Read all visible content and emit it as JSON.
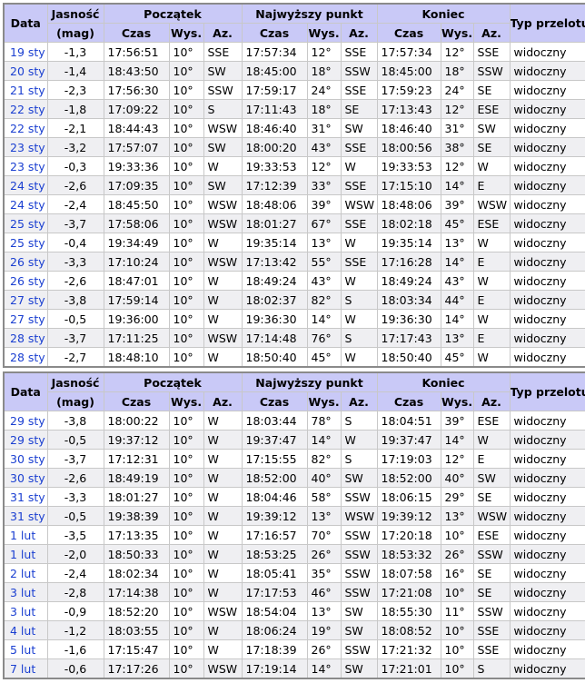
{
  "headers": {
    "date": "Data",
    "mag_top": "Jasność",
    "mag_bottom": "(mag)",
    "start": "Początek",
    "peak": "Najwyższy punkt",
    "end": "Koniec",
    "type": "Typ przelotu",
    "time": "Czas",
    "alt": "Wys.",
    "az": "Az."
  },
  "tables": [
    {
      "rows": [
        [
          "19 sty",
          "-1,3",
          "17:56:51",
          "10°",
          "SSE",
          "17:57:34",
          "12°",
          "SSE",
          "17:57:34",
          "12°",
          "SSE",
          "widoczny"
        ],
        [
          "20 sty",
          "-1,4",
          "18:43:50",
          "10°",
          "SW",
          "18:45:00",
          "18°",
          "SSW",
          "18:45:00",
          "18°",
          "SSW",
          "widoczny"
        ],
        [
          "21 sty",
          "-2,3",
          "17:56:30",
          "10°",
          "SSW",
          "17:59:17",
          "24°",
          "SSE",
          "17:59:23",
          "24°",
          "SE",
          "widoczny"
        ],
        [
          "22 sty",
          "-1,8",
          "17:09:22",
          "10°",
          "S",
          "17:11:43",
          "18°",
          "SE",
          "17:13:43",
          "12°",
          "ESE",
          "widoczny"
        ],
        [
          "22 sty",
          "-2,1",
          "18:44:43",
          "10°",
          "WSW",
          "18:46:40",
          "31°",
          "SW",
          "18:46:40",
          "31°",
          "SW",
          "widoczny"
        ],
        [
          "23 sty",
          "-3,2",
          "17:57:07",
          "10°",
          "SW",
          "18:00:20",
          "43°",
          "SSE",
          "18:00:56",
          "38°",
          "SE",
          "widoczny"
        ],
        [
          "23 sty",
          "-0,3",
          "19:33:36",
          "10°",
          "W",
          "19:33:53",
          "12°",
          "W",
          "19:33:53",
          "12°",
          "W",
          "widoczny"
        ],
        [
          "24 sty",
          "-2,6",
          "17:09:35",
          "10°",
          "SW",
          "17:12:39",
          "33°",
          "SSE",
          "17:15:10",
          "14°",
          "E",
          "widoczny"
        ],
        [
          "24 sty",
          "-2,4",
          "18:45:50",
          "10°",
          "WSW",
          "18:48:06",
          "39°",
          "WSW",
          "18:48:06",
          "39°",
          "WSW",
          "widoczny"
        ],
        [
          "25 sty",
          "-3,7",
          "17:58:06",
          "10°",
          "WSW",
          "18:01:27",
          "67°",
          "SSE",
          "18:02:18",
          "45°",
          "ESE",
          "widoczny"
        ],
        [
          "25 sty",
          "-0,4",
          "19:34:49",
          "10°",
          "W",
          "19:35:14",
          "13°",
          "W",
          "19:35:14",
          "13°",
          "W",
          "widoczny"
        ],
        [
          "26 sty",
          "-3,3",
          "17:10:24",
          "10°",
          "WSW",
          "17:13:42",
          "55°",
          "SSE",
          "17:16:28",
          "14°",
          "E",
          "widoczny"
        ],
        [
          "26 sty",
          "-2,6",
          "18:47:01",
          "10°",
          "W",
          "18:49:24",
          "43°",
          "W",
          "18:49:24",
          "43°",
          "W",
          "widoczny"
        ],
        [
          "27 sty",
          "-3,8",
          "17:59:14",
          "10°",
          "W",
          "18:02:37",
          "82°",
          "S",
          "18:03:34",
          "44°",
          "E",
          "widoczny"
        ],
        [
          "27 sty",
          "-0,5",
          "19:36:00",
          "10°",
          "W",
          "19:36:30",
          "14°",
          "W",
          "19:36:30",
          "14°",
          "W",
          "widoczny"
        ],
        [
          "28 sty",
          "-3,7",
          "17:11:25",
          "10°",
          "WSW",
          "17:14:48",
          "76°",
          "S",
          "17:17:43",
          "13°",
          "E",
          "widoczny"
        ],
        [
          "28 sty",
          "-2,7",
          "18:48:10",
          "10°",
          "W",
          "18:50:40",
          "45°",
          "W",
          "18:50:40",
          "45°",
          "W",
          "widoczny"
        ]
      ]
    },
    {
      "rows": [
        [
          "29 sty",
          "-3,8",
          "18:00:22",
          "10°",
          "W",
          "18:03:44",
          "78°",
          "S",
          "18:04:51",
          "39°",
          "ESE",
          "widoczny"
        ],
        [
          "29 sty",
          "-0,5",
          "19:37:12",
          "10°",
          "W",
          "19:37:47",
          "14°",
          "W",
          "19:37:47",
          "14°",
          "W",
          "widoczny"
        ],
        [
          "30 sty",
          "-3,7",
          "17:12:31",
          "10°",
          "W",
          "17:15:55",
          "82°",
          "S",
          "17:19:03",
          "12°",
          "E",
          "widoczny"
        ],
        [
          "30 sty",
          "-2,6",
          "18:49:19",
          "10°",
          "W",
          "18:52:00",
          "40°",
          "SW",
          "18:52:00",
          "40°",
          "SW",
          "widoczny"
        ],
        [
          "31 sty",
          "-3,3",
          "18:01:27",
          "10°",
          "W",
          "18:04:46",
          "58°",
          "SSW",
          "18:06:15",
          "29°",
          "SE",
          "widoczny"
        ],
        [
          "31 sty",
          "-0,5",
          "19:38:39",
          "10°",
          "W",
          "19:39:12",
          "13°",
          "WSW",
          "19:39:12",
          "13°",
          "WSW",
          "widoczny"
        ],
        [
          "1 lut",
          "-3,5",
          "17:13:35",
          "10°",
          "W",
          "17:16:57",
          "70°",
          "SSW",
          "17:20:18",
          "10°",
          "ESE",
          "widoczny"
        ],
        [
          "1 lut",
          "-2,0",
          "18:50:33",
          "10°",
          "W",
          "18:53:25",
          "26°",
          "SSW",
          "18:53:32",
          "26°",
          "SSW",
          "widoczny"
        ],
        [
          "2 lut",
          "-2,4",
          "18:02:34",
          "10°",
          "W",
          "18:05:41",
          "35°",
          "SSW",
          "18:07:58",
          "16°",
          "SE",
          "widoczny"
        ],
        [
          "3 lut",
          "-2,8",
          "17:14:38",
          "10°",
          "W",
          "17:17:53",
          "46°",
          "SSW",
          "17:21:08",
          "10°",
          "SE",
          "widoczny"
        ],
        [
          "3 lut",
          "-0,9",
          "18:52:20",
          "10°",
          "WSW",
          "18:54:04",
          "13°",
          "SW",
          "18:55:30",
          "11°",
          "SSW",
          "widoczny"
        ],
        [
          "4 lut",
          "-1,2",
          "18:03:55",
          "10°",
          "W",
          "18:06:24",
          "19°",
          "SW",
          "18:08:52",
          "10°",
          "SSE",
          "widoczny"
        ],
        [
          "5 lut",
          "-1,6",
          "17:15:47",
          "10°",
          "W",
          "17:18:39",
          "26°",
          "SSW",
          "17:21:32",
          "10°",
          "SSE",
          "widoczny"
        ],
        [
          "7 lut",
          "-0,6",
          "17:17:26",
          "10°",
          "WSW",
          "17:19:14",
          "14°",
          "SW",
          "17:21:01",
          "10°",
          "S",
          "widoczny"
        ]
      ]
    }
  ]
}
